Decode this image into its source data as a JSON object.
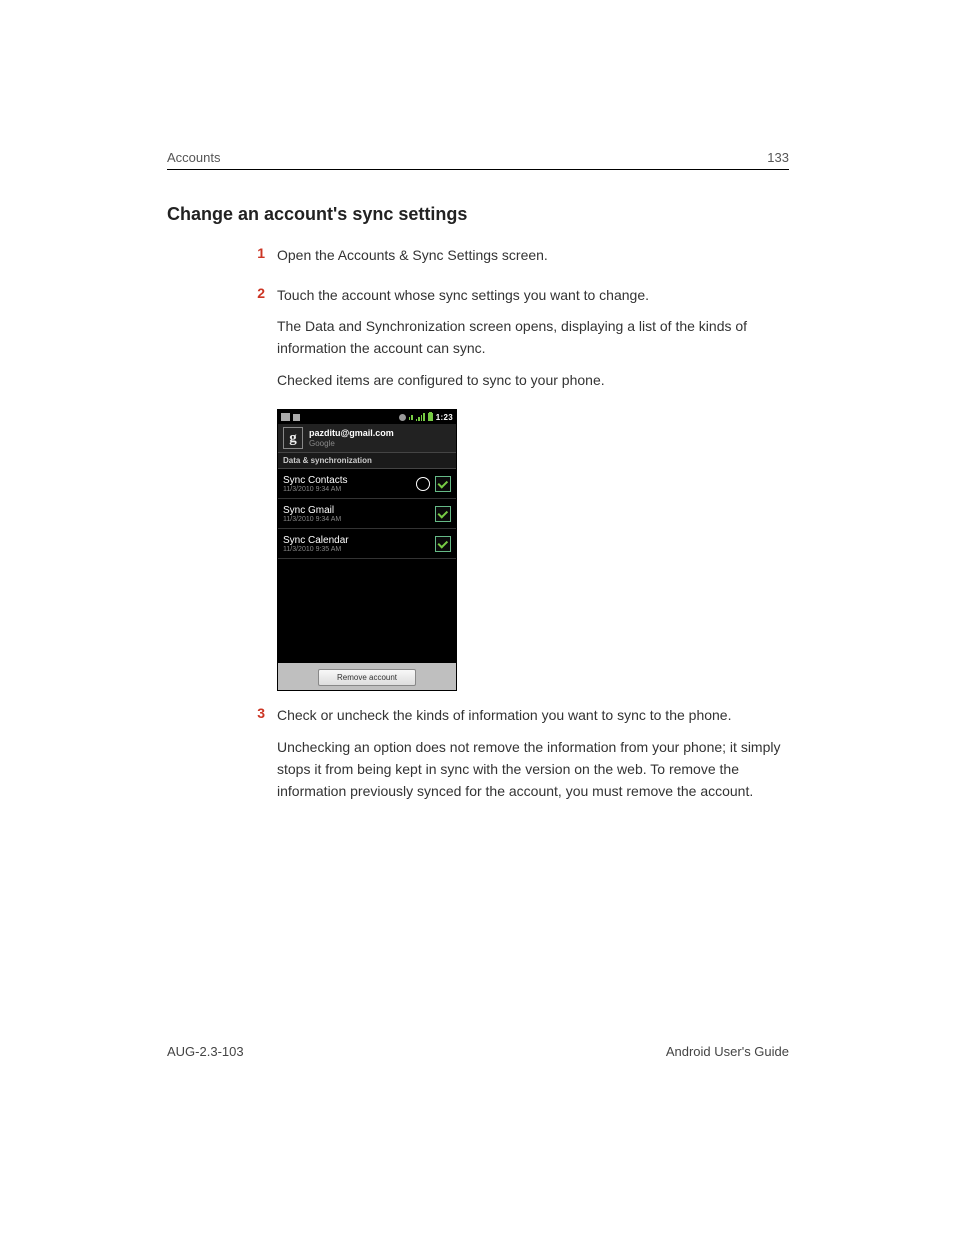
{
  "header": {
    "section": "Accounts",
    "page_number": "133"
  },
  "title": "Change an account's sync settings",
  "steps": [
    {
      "n": "1",
      "paras": [
        "Open the Accounts & Sync Settings screen."
      ]
    },
    {
      "n": "2",
      "paras": [
        "Touch the account whose sync settings you want to change.",
        "The Data and Synchronization screen opens, displaying a list of the kinds of information the account can sync.",
        "Checked items are configured to sync to your phone."
      ]
    },
    {
      "n": "3",
      "paras": [
        "Check or uncheck the kinds of information you want to sync to the phone.",
        "Unchecking an option does not remove the information from your phone; it simply stops it from being kept in sync with the version on the web. To remove the information previously synced for the account, you must remove the account."
      ]
    }
  ],
  "phone": {
    "clock": "1:23",
    "account_email": "pazditu@gmail.com",
    "account_provider": "Google",
    "section_label": "Data & synchronization",
    "rows": [
      {
        "title": "Sync Contacts",
        "time": "11/3/2010 9:34 AM",
        "syncing": true,
        "checked": true
      },
      {
        "title": "Sync Gmail",
        "time": "11/3/2010 9:34 AM",
        "syncing": false,
        "checked": true
      },
      {
        "title": "Sync Calendar",
        "time": "11/3/2010 9:35 AM",
        "syncing": false,
        "checked": true
      }
    ],
    "remove_label": "Remove account"
  },
  "footer": {
    "left": "AUG-2.3-103",
    "right": "Android User's Guide"
  }
}
